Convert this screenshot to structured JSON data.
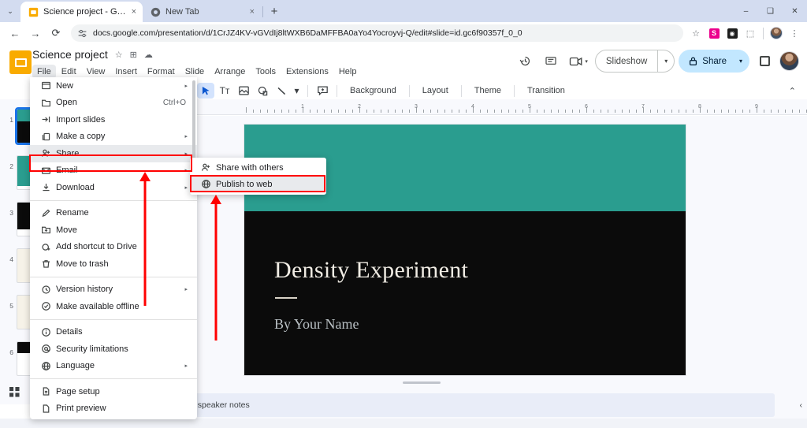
{
  "browser": {
    "tabs": [
      {
        "title": "Science project - Google Slides",
        "favicon": "slides-icon",
        "active": true,
        "close_label": "×"
      },
      {
        "title": "New Tab",
        "favicon": "chrome-icon",
        "active": false,
        "close_label": "×"
      }
    ],
    "new_tab_label": "+",
    "tab_list_caret": "⌄",
    "window_controls": {
      "minimize": "–",
      "maximize": "❑",
      "close": "✕"
    },
    "nav": {
      "back": "←",
      "forward": "→",
      "reload": "⟳"
    },
    "url": "docs.google.com/presentation/d/1CrJZ4KV-vGVdIj8ltWXB6DaMFFBA0aYo4Yocroyvj-Q/edit#slide=id.gc6f90357f_0_0",
    "site_settings_icon": "tune-icon",
    "omnibox_icons": {
      "bookmark": "☆",
      "ext1_label": "S",
      "ext2_label": "◉",
      "extensions": "⬚",
      "menu": "⋮"
    }
  },
  "slides": {
    "logo": "google-slides-logo",
    "doc_title": "Science project",
    "title_icons": {
      "star": "☆",
      "move": "⊞",
      "cloud": "☁"
    },
    "menus": [
      {
        "label": "File",
        "open": true
      },
      {
        "label": "Edit",
        "open": false
      },
      {
        "label": "View",
        "open": false
      },
      {
        "label": "Insert",
        "open": false
      },
      {
        "label": "Format",
        "open": false
      },
      {
        "label": "Slide",
        "open": false
      },
      {
        "label": "Arrange",
        "open": false
      },
      {
        "label": "Tools",
        "open": false
      },
      {
        "label": "Extensions",
        "open": false
      },
      {
        "label": "Help",
        "open": false
      }
    ],
    "header_right": {
      "history_icon": "version-history-icon",
      "comment_icon": "comment-icon",
      "meet_icon": "meet-camera-icon",
      "meet_caret": "▾",
      "slideshow_label": "Slideshow",
      "slideshow_caret": "▾",
      "share_label": "Share",
      "share_lock_icon": "lock-icon",
      "share_caret": "▾",
      "present_icon": "present-icon",
      "avatar": "user-avatar"
    },
    "toolbar": {
      "icons": [
        {
          "name": "select-tool",
          "glyph": "➤",
          "selected": true
        },
        {
          "name": "text-box-tool",
          "glyph": "Tᴛ",
          "selected": false
        },
        {
          "name": "insert-image-tool",
          "glyph": "Ὓb",
          "selected": false
        },
        {
          "name": "shape-tool",
          "glyph": "◯",
          "selected": false
        },
        {
          "name": "line-tool",
          "glyph": "╲",
          "selected": false
        },
        {
          "name": "line-caret",
          "glyph": "▾",
          "selected": false
        },
        {
          "name": "comment-add-tool",
          "glyph": "⊞",
          "selected": false
        }
      ],
      "text_buttons": [
        "Background",
        "Layout",
        "Theme",
        "Transition"
      ],
      "collapse_icon": "⌃"
    },
    "ruler": {
      "marks": [
        1,
        2,
        3,
        4,
        5,
        6,
        7,
        8,
        9
      ]
    },
    "filmstrip": {
      "grid_view_icon": "grid-view-icon",
      "slides": [
        {
          "number": "1",
          "selected": true,
          "style": "teal-black"
        },
        {
          "number": "2",
          "selected": false,
          "style": "teal"
        },
        {
          "number": "3",
          "selected": false,
          "style": "black"
        },
        {
          "number": "4",
          "selected": false,
          "style": "cream"
        },
        {
          "number": "5",
          "selected": false,
          "style": "cream-lines"
        },
        {
          "number": "6",
          "selected": false,
          "style": "black-partial"
        }
      ]
    },
    "slide": {
      "title": "Density Experiment",
      "subtitle": "By Your Name",
      "band_color": "#2a9d8f",
      "background_color": "#0b0b0b",
      "title_color": "#f0ece4",
      "subtitle_color": "#b9c0c4"
    },
    "notes": {
      "text": "Click to add speaker notes",
      "collapse_icon": "‹"
    }
  },
  "file_menu": {
    "items": [
      {
        "label": "New",
        "icon": "new-icon",
        "shortcut": "",
        "arrow": true,
        "highlight": false
      },
      {
        "label": "Open",
        "icon": "folder-icon",
        "shortcut": "Ctrl+O",
        "arrow": false,
        "highlight": false
      },
      {
        "label": "Import slides",
        "icon": "import-icon",
        "shortcut": "",
        "arrow": false,
        "highlight": false
      },
      {
        "label": "Make a copy",
        "icon": "copy-icon",
        "shortcut": "",
        "arrow": true,
        "highlight": false
      },
      {
        "label": "Share",
        "icon": "person-add-icon",
        "shortcut": "",
        "arrow": true,
        "highlight": true
      },
      {
        "label": "Email",
        "icon": "email-icon",
        "shortcut": "",
        "arrow": true,
        "highlight": false
      },
      {
        "label": "Download",
        "icon": "download-icon",
        "shortcut": "",
        "arrow": true,
        "highlight": false
      },
      {
        "label": "__SEP__",
        "icon": "",
        "shortcut": "",
        "arrow": false,
        "highlight": false
      },
      {
        "label": "Rename",
        "icon": "pencil-icon",
        "shortcut": "",
        "arrow": false,
        "highlight": false
      },
      {
        "label": "Move",
        "icon": "move-folder-icon",
        "shortcut": "",
        "arrow": false,
        "highlight": false
      },
      {
        "label": "Add shortcut to Drive",
        "icon": "drive-add-icon",
        "shortcut": "",
        "arrow": false,
        "highlight": false
      },
      {
        "label": "Move to trash",
        "icon": "trash-icon",
        "shortcut": "",
        "arrow": false,
        "highlight": false
      },
      {
        "label": "__SEP__",
        "icon": "",
        "shortcut": "",
        "arrow": false,
        "highlight": false
      },
      {
        "label": "Version history",
        "icon": "history-icon",
        "shortcut": "",
        "arrow": true,
        "highlight": false
      },
      {
        "label": "Make available offline",
        "icon": "offline-icon",
        "shortcut": "",
        "arrow": false,
        "highlight": false
      },
      {
        "label": "__SEP__",
        "icon": "",
        "shortcut": "",
        "arrow": false,
        "highlight": false
      },
      {
        "label": "Details",
        "icon": "info-icon",
        "shortcut": "",
        "arrow": false,
        "highlight": false
      },
      {
        "label": "Security limitations",
        "icon": "security-icon",
        "shortcut": "",
        "arrow": false,
        "highlight": false
      },
      {
        "label": "Language",
        "icon": "globe-icon",
        "shortcut": "",
        "arrow": true,
        "highlight": false
      },
      {
        "label": "__SEP__",
        "icon": "",
        "shortcut": "",
        "arrow": false,
        "highlight": false
      },
      {
        "label": "Page setup",
        "icon": "page-setup-icon",
        "shortcut": "",
        "arrow": false,
        "highlight": false
      },
      {
        "label": "Print preview",
        "icon": "print-icon",
        "shortcut": "",
        "arrow": false,
        "highlight": false
      }
    ]
  },
  "share_submenu": {
    "items": [
      {
        "label": "Share with others",
        "icon": "person-add-icon",
        "highlight": false
      },
      {
        "label": "Publish to web",
        "icon": "globe-icon",
        "highlight": true
      }
    ]
  },
  "annotations": {
    "accent_color": "#ff0000",
    "highlight_share_menu": true,
    "highlight_publish_to_web": true,
    "arrows": 2
  }
}
